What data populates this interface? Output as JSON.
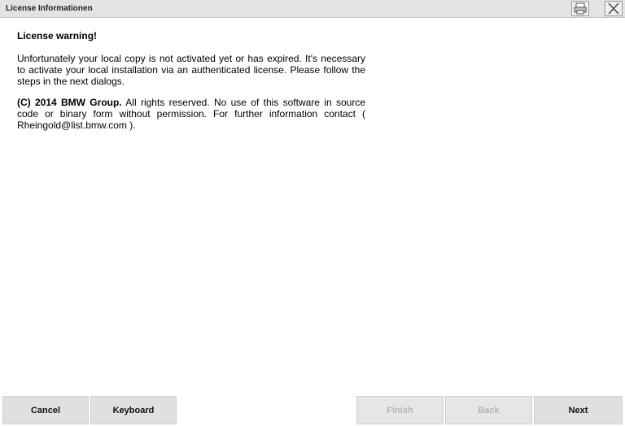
{
  "window": {
    "title": "License Informationen"
  },
  "content": {
    "heading": "License warning!",
    "paragraph1": "Unfortunately your local copy is not activated yet or has expired. It's necessary to activate your local installation via an authenticated license. Please follow the steps in the next dialogs.",
    "copyright_prefix": "(C) 2014 BMW Group.",
    "copyright_text": " All rights reserved. No use of this software in source code or binary form without permission. For further information contact ( Rheingold@list.bmw.com )."
  },
  "footer": {
    "cancel_label": "Cancel",
    "keyboard_label": "Keyboard",
    "finish_label": "Finish",
    "back_label": "Back",
    "next_label": "Next"
  },
  "icons": {
    "print": "printer-icon",
    "close": "close-icon"
  },
  "colors": {
    "titlebar": "#e3e3e3",
    "button": "#e0e0e0",
    "disabled_text": "#b5b5b5"
  }
}
